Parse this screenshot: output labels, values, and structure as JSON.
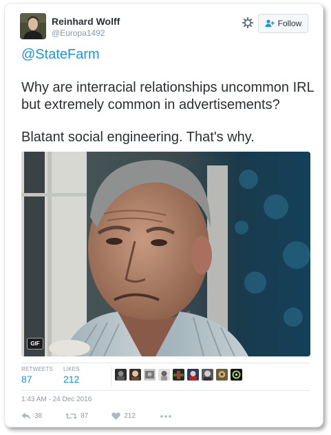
{
  "tweet": {
    "user": {
      "display_name": "Reinhard Wolff",
      "handle": "@Europa1492",
      "avatar_icon": "user-avatar-photo"
    },
    "settings_icon": "gear-icon",
    "follow_label": "Follow",
    "mention": "@StateFarm",
    "paragraphs": [
      "Why are interracial relationships uncommon IRL but extremely common in advertisements?",
      "Blatant social engineering. That's why."
    ],
    "media": {
      "badge": "GIF"
    },
    "stats": {
      "retweets_label": "RETWEETS",
      "retweets_value": "87",
      "likes_label": "LIKES",
      "likes_value": "212"
    },
    "timestamp": "1:43 AM - 24 Dec 2016",
    "actions": {
      "reply_count": "38",
      "retweet_count": "87",
      "like_count": "212"
    },
    "colors": {
      "link": "#1b95e0",
      "text": "#292f33",
      "muted": "#8899a6"
    }
  }
}
